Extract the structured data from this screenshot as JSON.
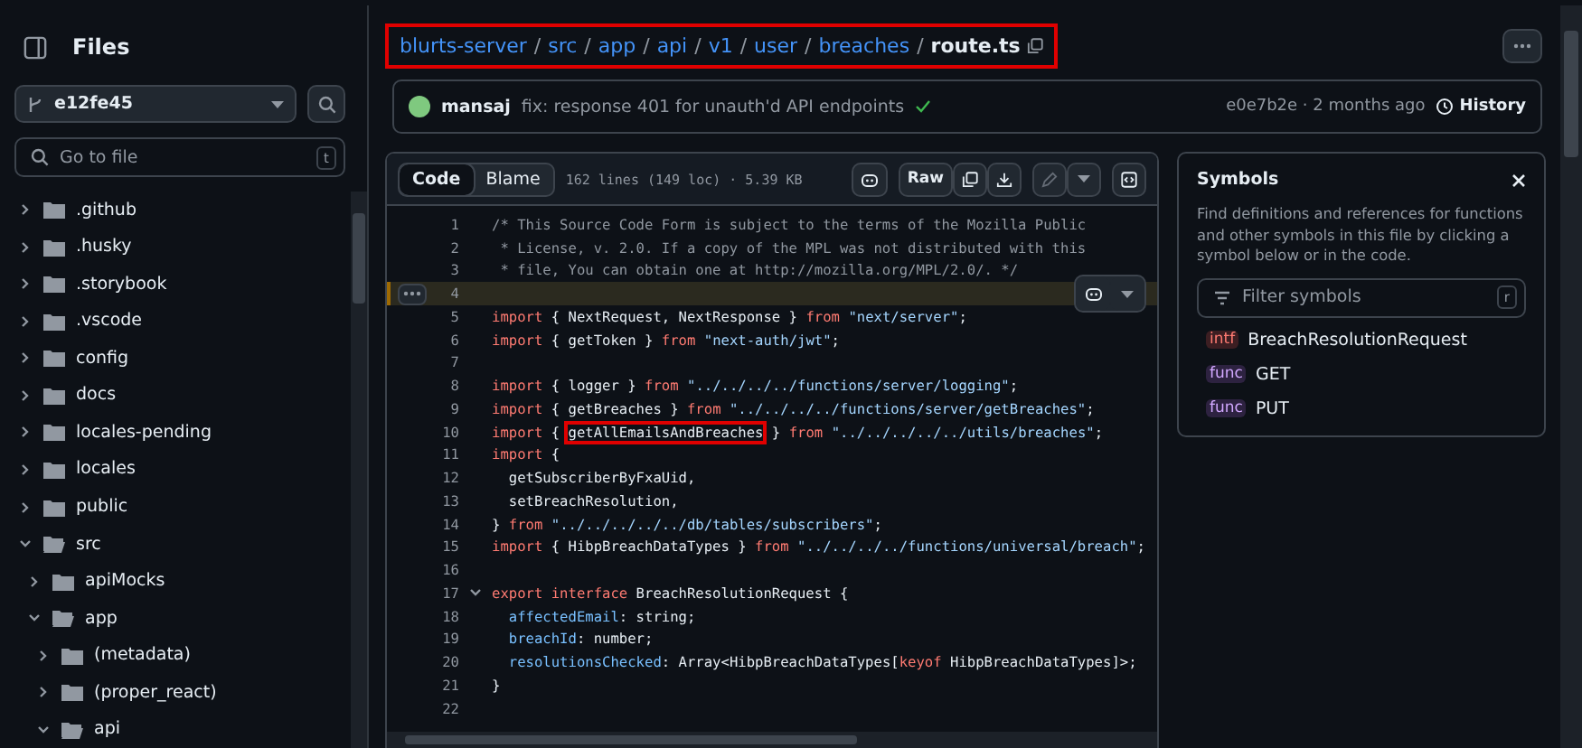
{
  "sidebar": {
    "title": "Files",
    "branch": "e12fe45",
    "search": {
      "placeholder": "Go to file",
      "shortcut": "t"
    },
    "tree": [
      {
        "name": ".github",
        "expanded": false
      },
      {
        "name": ".husky",
        "expanded": false
      },
      {
        "name": ".storybook",
        "expanded": false
      },
      {
        "name": ".vscode",
        "expanded": false
      },
      {
        "name": "config",
        "expanded": false
      },
      {
        "name": "docs",
        "expanded": false
      },
      {
        "name": "locales-pending",
        "expanded": false
      },
      {
        "name": "locales",
        "expanded": false
      },
      {
        "name": "public",
        "expanded": false
      },
      {
        "name": "src",
        "expanded": true,
        "children": [
          {
            "name": "apiMocks",
            "expanded": false
          },
          {
            "name": "app",
            "expanded": true,
            "children": [
              {
                "name": "(metadata)",
                "expanded": false
              },
              {
                "name": "(proper_react)",
                "expanded": false
              },
              {
                "name": "api",
                "expanded": true
              }
            ]
          }
        ]
      }
    ]
  },
  "breadcrumb": {
    "annotated": true,
    "separator": "/",
    "parts": [
      {
        "text": "blurts-server",
        "kind": "link"
      },
      {
        "text": "src",
        "kind": "link"
      },
      {
        "text": "app",
        "kind": "link"
      },
      {
        "text": "api",
        "kind": "link"
      },
      {
        "text": "v1",
        "kind": "link"
      },
      {
        "text": "user",
        "kind": "link"
      },
      {
        "text": "breaches",
        "kind": "link"
      },
      {
        "text": "route.ts",
        "kind": "current"
      }
    ]
  },
  "commit": {
    "author": "mansaj",
    "message": "fix: response 401 for unauth'd API endpoints",
    "passed": true,
    "meta": "e0e7b2e · 2 months ago",
    "history": "History"
  },
  "toolbar": {
    "tabs": [
      {
        "label": "Code",
        "selected": true
      },
      {
        "label": "Blame",
        "selected": false
      }
    ],
    "info": "162 lines (149 loc) · 5.39 KB",
    "raw": "Raw"
  },
  "code": [
    {
      "number": "1",
      "selected": false,
      "tokens": [
        {
          "kind": "comment",
          "text": "/* This Source Code Form is subject to the terms of the Mozilla Public"
        }
      ]
    },
    {
      "number": "2",
      "selected": false,
      "tokens": [
        {
          "kind": "comment",
          "text": " * License, v. 2.0. If a copy of the MPL was not distributed with this"
        }
      ]
    },
    {
      "number": "3",
      "selected": false,
      "tokens": [
        {
          "kind": "comment",
          "text": " * file, You can obtain one at http://mozilla.org/MPL/2.0/. */"
        }
      ]
    },
    {
      "number": "4",
      "selected": true
    },
    {
      "number": "5",
      "selected": false,
      "tokens": [
        {
          "kind": "keyword",
          "text": "import"
        },
        {
          "kind": "plain",
          "text": " { NextRequest, NextResponse } "
        },
        {
          "kind": "keyword",
          "text": "from "
        },
        {
          "kind": "string",
          "text": "\"next/server\""
        },
        {
          "kind": "plain",
          "text": ";"
        }
      ]
    },
    {
      "number": "6",
      "selected": false,
      "tokens": [
        {
          "kind": "keyword",
          "text": "import"
        },
        {
          "kind": "plain",
          "text": " { getToken } "
        },
        {
          "kind": "keyword",
          "text": "from "
        },
        {
          "kind": "string",
          "text": "\"next-auth/jwt\""
        },
        {
          "kind": "plain",
          "text": ";"
        }
      ]
    },
    {
      "number": "7",
      "selected": false
    },
    {
      "number": "8",
      "selected": false,
      "tokens": [
        {
          "kind": "keyword",
          "text": "import"
        },
        {
          "kind": "plain",
          "text": " { logger } "
        },
        {
          "kind": "keyword",
          "text": "from "
        },
        {
          "kind": "string",
          "text": "\"../../../../functions/server/logging\""
        },
        {
          "kind": "plain",
          "text": ";"
        }
      ]
    },
    {
      "number": "9",
      "selected": false,
      "tokens": [
        {
          "kind": "keyword",
          "text": "import"
        },
        {
          "kind": "plain",
          "text": " { getBreaches } "
        },
        {
          "kind": "keyword",
          "text": "from "
        },
        {
          "kind": "string",
          "text": "\"../../../../functions/server/getBreaches\""
        },
        {
          "kind": "plain",
          "text": ";"
        }
      ]
    },
    {
      "number": "10",
      "selected": false,
      "tokens": [
        {
          "kind": "keyword",
          "text": "import"
        },
        {
          "kind": "plain",
          "text": " { "
        },
        {
          "kind": "plain",
          "text": "getAllEmailsAndBreaches",
          "highlighted": true
        },
        {
          "kind": "plain",
          "text": " } "
        },
        {
          "kind": "keyword",
          "text": "from "
        },
        {
          "kind": "string",
          "text": "\"../../../../../utils/breaches\""
        },
        {
          "kind": "plain",
          "text": ";"
        }
      ]
    },
    {
      "number": "11",
      "selected": false,
      "tokens": [
        {
          "kind": "keyword",
          "text": "import"
        },
        {
          "kind": "plain",
          "text": " {"
        }
      ]
    },
    {
      "number": "12",
      "selected": false,
      "tokens": [
        {
          "kind": "plain",
          "text": "  getSubscriberByFxaUid,"
        }
      ]
    },
    {
      "number": "13",
      "selected": false,
      "tokens": [
        {
          "kind": "plain",
          "text": "  setBreachResolution,"
        }
      ]
    },
    {
      "number": "14",
      "selected": false,
      "tokens": [
        {
          "kind": "plain",
          "text": "} "
        },
        {
          "kind": "keyword",
          "text": "from "
        },
        {
          "kind": "string",
          "text": "\"../../../../../db/tables/subscribers\""
        },
        {
          "kind": "plain",
          "text": ";"
        }
      ]
    },
    {
      "number": "15",
      "selected": false,
      "tokens": [
        {
          "kind": "keyword",
          "text": "import"
        },
        {
          "kind": "plain",
          "text": " { HibpBreachDataTypes } "
        },
        {
          "kind": "keyword",
          "text": "from "
        },
        {
          "kind": "string",
          "text": "\"../../../../functions/universal/breach\""
        },
        {
          "kind": "plain",
          "text": ";"
        }
      ]
    },
    {
      "number": "16",
      "selected": false
    },
    {
      "number": "17",
      "selected": false,
      "foldable": true,
      "tokens": [
        {
          "kind": "keyword",
          "text": "export interface"
        },
        {
          "kind": "plain",
          "text": " BreachResolutionRequest {"
        }
      ]
    },
    {
      "number": "18",
      "selected": false,
      "tokens": [
        {
          "kind": "property",
          "text": "  affectedEmail"
        },
        {
          "kind": "plain",
          "text": ": string;"
        }
      ]
    },
    {
      "number": "19",
      "selected": false,
      "tokens": [
        {
          "kind": "property",
          "text": "  breachId"
        },
        {
          "kind": "plain",
          "text": ": number;"
        }
      ]
    },
    {
      "number": "20",
      "selected": false,
      "tokens": [
        {
          "kind": "property",
          "text": "  resolutionsChecked"
        },
        {
          "kind": "plain",
          "text": ": Array<HibpBreachDataTypes["
        },
        {
          "kind": "keyword",
          "text": "keyof"
        },
        {
          "kind": "plain",
          "text": " HibpBreachDataTypes]>;"
        }
      ]
    },
    {
      "number": "21",
      "selected": false,
      "tokens": [
        {
          "kind": "plain",
          "text": "}"
        }
      ]
    },
    {
      "number": "22",
      "selected": false
    }
  ],
  "symbols": {
    "title": "Symbols",
    "description": "Find definitions and references for functions and other symbols in this file by clicking a symbol below or in the code.",
    "filter": {
      "placeholder": "Filter symbols",
      "shortcut": "r"
    },
    "items": [
      {
        "kind": "intf",
        "name": "BreachResolutionRequest"
      },
      {
        "kind": "func",
        "name": "GET"
      },
      {
        "kind": "func",
        "name": "PUT"
      }
    ]
  }
}
